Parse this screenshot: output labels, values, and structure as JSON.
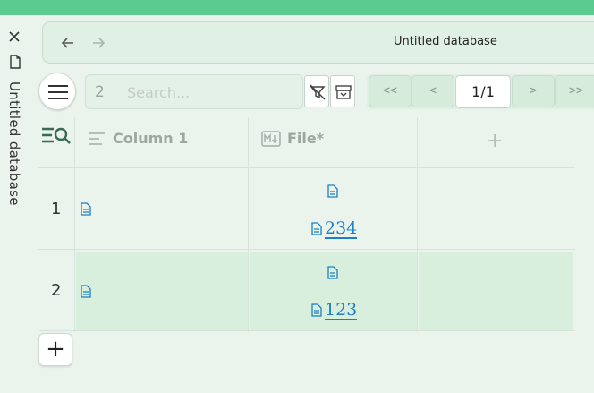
{
  "window": {
    "title": "Untitled database"
  },
  "nav": {
    "title": "Untitled database"
  },
  "toolbar": {
    "match_count": "2",
    "search_placeholder": "Search...",
    "pager": {
      "first": "<<",
      "prev": "<",
      "page": "1/1",
      "next": ">",
      "last": ">>"
    }
  },
  "table": {
    "columns": [
      {
        "label": "Column 1",
        "icon": "text-align-icon"
      },
      {
        "label": "File*",
        "icon": "markdown-icon"
      }
    ],
    "add_column": "+",
    "rows": [
      {
        "num": "1",
        "file_link": "234"
      },
      {
        "num": "2",
        "file_link": "123"
      }
    ],
    "add_row": "+"
  },
  "colors": {
    "topbar": "#5ccb90",
    "link": "#1d7fc4",
    "background": "#eaf3ec",
    "selected_row": "#d9efdd"
  }
}
